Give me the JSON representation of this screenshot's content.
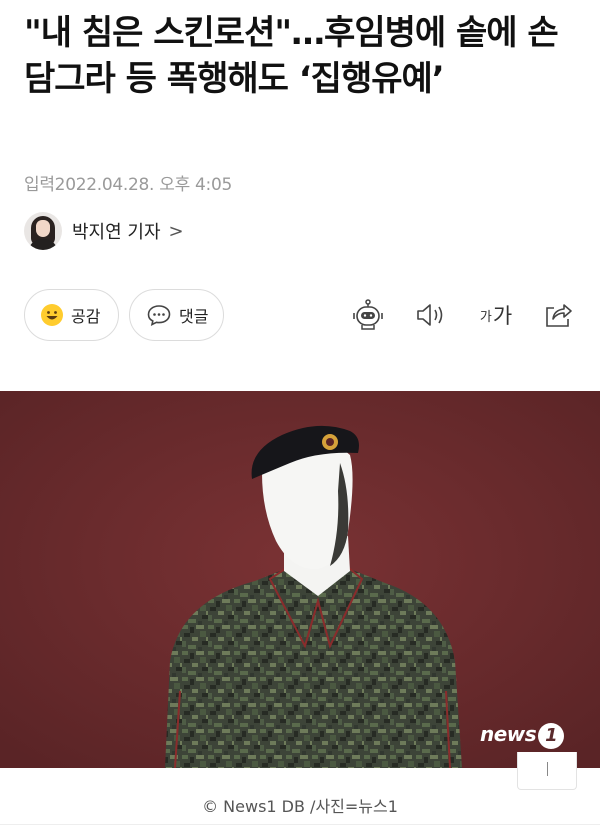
{
  "article": {
    "title": "\"내 침은 스킨로션\"…후임병에 솥에 손 담그라 등 폭행해도 ‘집행유예’",
    "date": "입력2022.04.28. 오후 4:05"
  },
  "reporter": {
    "name": "박지연 기자",
    "arrow": ">"
  },
  "actions": {
    "like_label": "공감",
    "comment_label": "댓글",
    "font_small": "가",
    "font_large": "가"
  },
  "icons": {
    "like": "smiley-icon",
    "comment": "speech-bubble-icon",
    "summary": "robot-icon",
    "listen": "speaker-icon",
    "share": "share-icon"
  },
  "photo": {
    "watermark": "news",
    "watermark_num": "1",
    "caption": "© News1 DB /사진=뉴스1",
    "background_color": "#6e2a2c"
  }
}
